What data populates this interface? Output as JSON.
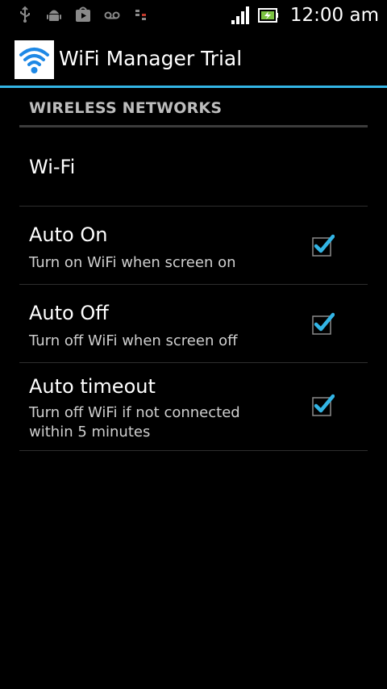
{
  "status_bar": {
    "time": "12:00 am",
    "icons": [
      "usb-icon",
      "android-debug-icon",
      "play-store-icon",
      "voicemail-icon",
      "data-transfer-icon",
      "signal-icon",
      "battery-charging-icon"
    ]
  },
  "app_bar": {
    "title": "WiFi Manager Trial",
    "icon": "wifi-app-icon"
  },
  "section": {
    "header": "WIRELESS NETWORKS"
  },
  "preferences": [
    {
      "title": "Wi-Fi"
    },
    {
      "title": "Auto On",
      "summary": "Turn on WiFi when screen on",
      "checked": true
    },
    {
      "title": "Auto Off",
      "summary": "Turn off WiFi when screen off",
      "checked": true
    },
    {
      "title": "Auto timeout",
      "summary": "Turn off WiFi if not connected within 5 minutes",
      "checked": true
    }
  ],
  "colors": {
    "accent": "#33b5e5",
    "background": "#000000",
    "divider": "#2e2e2e"
  }
}
